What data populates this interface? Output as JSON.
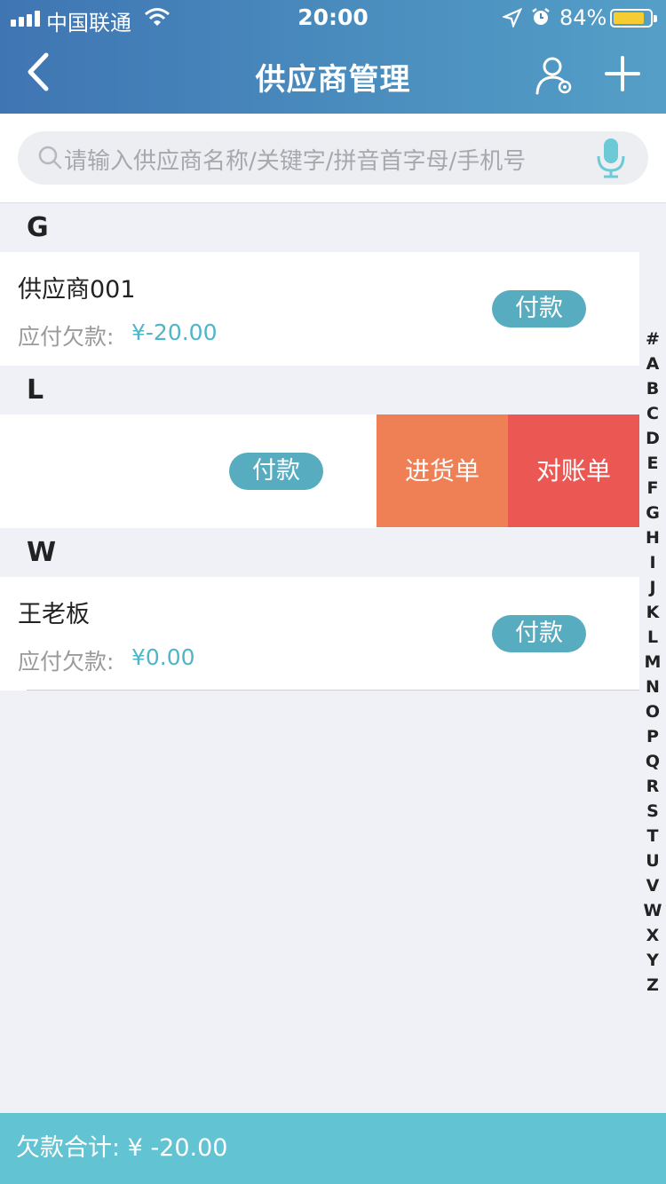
{
  "status_bar": {
    "carrier": "中国联通",
    "time": "20:00",
    "battery_percent": "84%",
    "battery_level": 0.84,
    "icons": [
      "signal-icon",
      "wifi-icon",
      "location-icon",
      "alarm-icon",
      "battery-icon"
    ]
  },
  "nav": {
    "title": "供应商管理",
    "back_icon": "chevron-left-icon",
    "user_settings_icon": "user-settings-icon",
    "add_icon": "plus-icon"
  },
  "search": {
    "placeholder": "请输入供应商名称/关键字/拼音首字母/手机号",
    "icon": "search-icon",
    "mic_icon": "microphone-icon"
  },
  "sections": [
    {
      "letter": "G",
      "rows": [
        {
          "name": "供应商001",
          "debt_label": "应付欠款:",
          "debt_value": "¥-20.00",
          "pay_label": "付款"
        }
      ]
    },
    {
      "letter": "L",
      "rows": [
        {
          "pay_label": "付款",
          "swipe_purchase": "进货单",
          "swipe_reconcile": "对账单"
        }
      ]
    },
    {
      "letter": "W",
      "rows": [
        {
          "name": "王老板",
          "debt_label": "应付欠款:",
          "debt_value": "¥0.00",
          "pay_label": "付款"
        }
      ]
    }
  ],
  "index_letters": [
    "#",
    "A",
    "B",
    "C",
    "D",
    "E",
    "F",
    "G",
    "H",
    "I",
    "J",
    "K",
    "L",
    "M",
    "N",
    "O",
    "P",
    "Q",
    "R",
    "S",
    "T",
    "U",
    "V",
    "W",
    "X",
    "Y",
    "Z"
  ],
  "footer": {
    "total_text": "欠款合计: ¥ -20.00"
  },
  "colors": {
    "header_start": "#3f75b3",
    "header_end": "#549fc8",
    "accent": "#58acc0",
    "swipe_purchase": "#ef7f55",
    "swipe_reconcile": "#eb5853",
    "footer": "#62c3d3",
    "battery": "#f5cc32"
  }
}
